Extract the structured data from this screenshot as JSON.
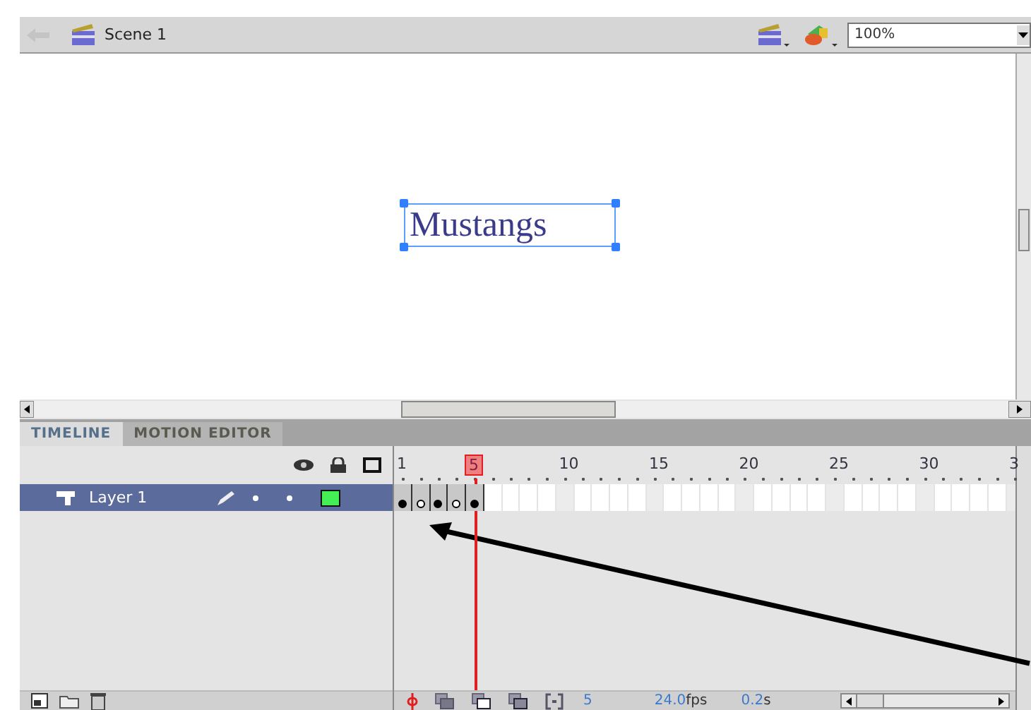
{
  "edit_bar": {
    "scene": "Scene 1",
    "zoom": "100%"
  },
  "stage": {
    "text": "Mustangs",
    "selected": true
  },
  "tabs": [
    {
      "label": "TIMELINE",
      "selected": true
    },
    {
      "label": "MOTION EDITOR",
      "selected": false
    }
  ],
  "ruler": [
    {
      "text": "1",
      "selected": false
    },
    {
      "text": "5",
      "selected": true
    },
    {
      "text": "10",
      "selected": false
    },
    {
      "text": "15",
      "selected": false
    },
    {
      "text": "20",
      "selected": false
    },
    {
      "text": "25",
      "selected": false
    },
    {
      "text": "30",
      "selected": false
    },
    {
      "text": "3",
      "selected": false
    }
  ],
  "layers": [
    {
      "name": "Layer 1",
      "selected": true,
      "frames": [
        {
          "kind": "keyframe"
        },
        {
          "kind": "blank_keyframe"
        },
        {
          "kind": "keyframe"
        },
        {
          "kind": "blank_keyframe"
        },
        {
          "kind": "keyframe"
        }
      ]
    }
  ],
  "status": {
    "current_frame": "5",
    "fps": "24.0",
    "fps_unit": "fps",
    "elapsed": "0.2",
    "elapsed_unit": "s"
  }
}
